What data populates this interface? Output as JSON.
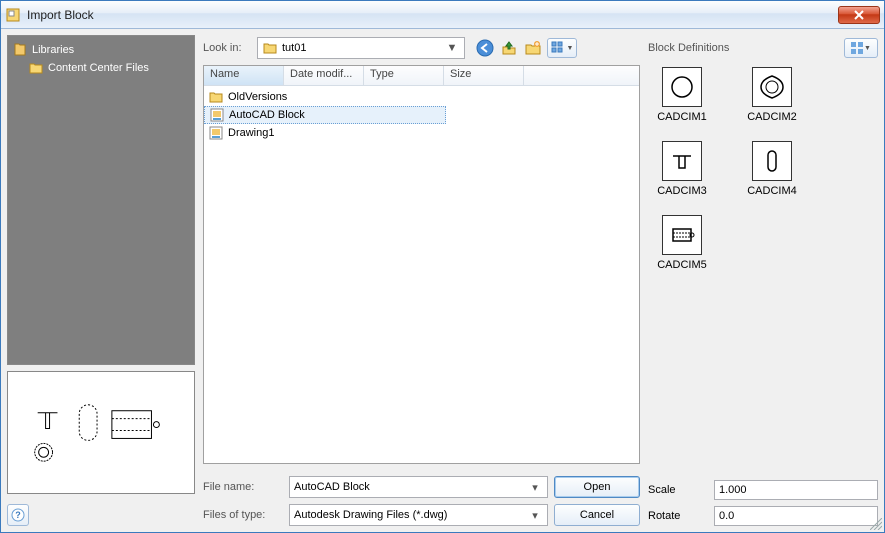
{
  "window": {
    "title": "Import Block"
  },
  "tree": {
    "root": "Libraries",
    "child": "Content Center Files"
  },
  "lookin": {
    "label": "Look in:",
    "value": "tut01"
  },
  "columns": {
    "name": "Name",
    "date": "Date modif...",
    "type": "Type",
    "size": "Size"
  },
  "files": [
    {
      "name": "OldVersions",
      "kind": "folder"
    },
    {
      "name": "AutoCAD Block",
      "kind": "dwg",
      "selected": true
    },
    {
      "name": "Drawing1",
      "kind": "dwg"
    }
  ],
  "controls": {
    "filename_label": "File name:",
    "filename_value": "AutoCAD Block",
    "filetype_label": "Files of type:",
    "filetype_value": "Autodesk Drawing Files (*.dwg)",
    "open": "Open",
    "cancel": "Cancel"
  },
  "blockdefs": {
    "label": "Block Definitions",
    "items": [
      "CADCIM1",
      "CADCIM2",
      "CADCIM3",
      "CADCIM4",
      "CADCIM5"
    ]
  },
  "scale": {
    "label": "Scale",
    "value": "1.000"
  },
  "rotate": {
    "label": "Rotate",
    "value": "0.0"
  }
}
